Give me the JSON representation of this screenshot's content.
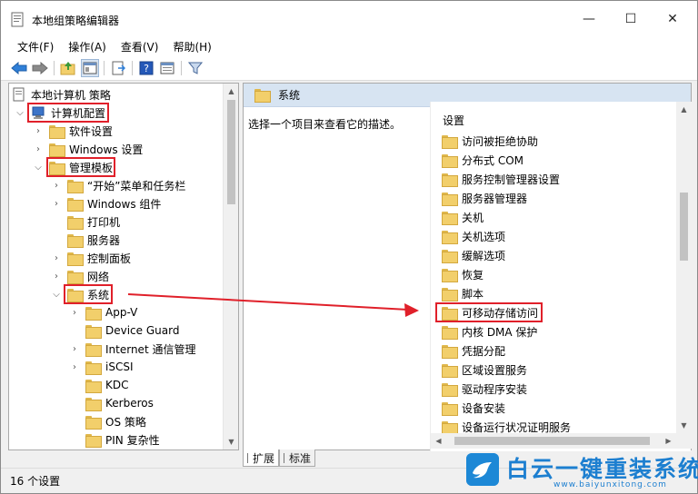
{
  "window": {
    "title": "本地组策略编辑器",
    "controls": {
      "minimize": "—",
      "maximize": "☐",
      "close": "✕"
    }
  },
  "menu": [
    "文件(F)",
    "操作(A)",
    "查看(V)",
    "帮助(H)"
  ],
  "toolbar": {
    "buttons": [
      "back-icon",
      "forward-icon",
      "up-folder-icon",
      "show-hide-tree-icon",
      "export-list-icon",
      "help-icon",
      "properties-icon",
      "filter-icon"
    ]
  },
  "tree": {
    "root": "本地计算机 策略",
    "computer_config": "计算机配置",
    "software_settings": "软件设置",
    "windows_settings": "Windows 设置",
    "admin_templates": "管理模板",
    "start_menu": "“开始”菜单和任务栏",
    "windows_components": "Windows 组件",
    "printers": "打印机",
    "server": "服务器",
    "control_panel": "控制面板",
    "network": "网络",
    "system": "系统",
    "system_children": [
      "App-V",
      "Device Guard",
      "Internet 通信管理",
      "iSCSI",
      "KDC",
      "Kerberos",
      "OS 策略",
      "PIN 复杂性"
    ]
  },
  "right_pane": {
    "header": "系统",
    "description": "选择一个项目来查看它的描述。",
    "column_header": "设置",
    "items": [
      "访问被拒绝协助",
      "分布式 COM",
      "服务控制管理器设置",
      "服务器管理器",
      "关机",
      "关机选项",
      "缓解选项",
      "恢复",
      "脚本",
      "可移动存储访问",
      "内核 DMA 保护",
      "凭据分配",
      "区域设置服务",
      "驱动程序安装",
      "设备安装",
      "设备运行状况证明服务"
    ],
    "highlighted_item": "可移动存储访问"
  },
  "tabs": [
    "扩展",
    "标准"
  ],
  "status": "16 个设置",
  "watermark": {
    "main": "白云一键重装系统",
    "url": "www.baiyunxitong.com"
  },
  "colors": {
    "highlight": "#e0202a",
    "accent": "#1d7fd0"
  }
}
